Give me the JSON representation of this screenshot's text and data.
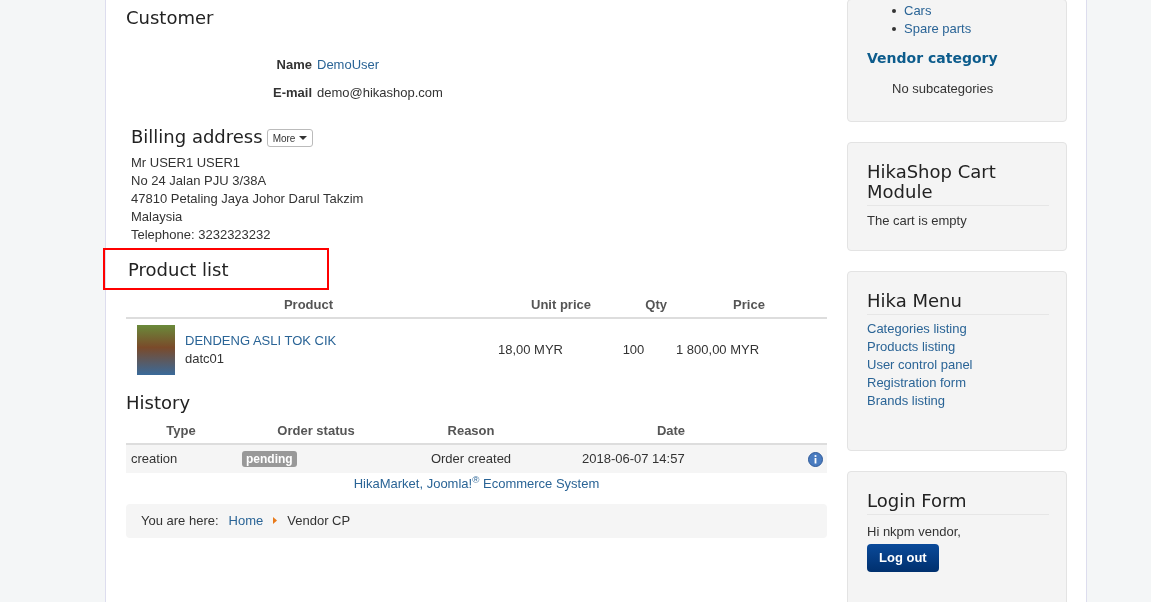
{
  "customer": {
    "title": "Customer",
    "fields": [
      {
        "label": "Name",
        "value": "DemoUser",
        "kind": "link"
      },
      {
        "label": "E-mail",
        "value": "demo@hikashop.com",
        "kind": "text"
      }
    ]
  },
  "billing": {
    "title": "Billing address",
    "more_button": "More",
    "lines": [
      "Mr USER1 USER1",
      "No 24 Jalan PJU 3/38A",
      "47810 Petaling Jaya Johor Darul Takzim",
      "Malaysia",
      "Telephone: 3232323232"
    ]
  },
  "product_list": {
    "title": "Product list",
    "highlighted": true,
    "columns": [
      "Product",
      "Unit price",
      "Qty",
      "Price"
    ],
    "rows": [
      {
        "name": "DENDENG ASLI TOK CIK",
        "code": "datc01",
        "unit_price": "18,00 MYR",
        "qty": "100",
        "price": "1 800,00 MYR"
      }
    ]
  },
  "history": {
    "title": "History",
    "columns": [
      "Type",
      "Order status",
      "Reason",
      "Date"
    ],
    "rows": [
      {
        "type": "creation",
        "status": "pending",
        "reason": "Order created",
        "date": "2018-06-07 14:57"
      }
    ]
  },
  "footer_link": "HikaMarket, Joomla!$^{®}$ Ecommerce System",
  "breadcrumb": {
    "label": "You are here:",
    "items": [
      {
        "text": "Home",
        "kind": "link"
      },
      {
        "text": "Vendor CP",
        "kind": "current"
      }
    ]
  },
  "sidebar": {
    "categories": [
      "Cars",
      "Spare parts"
    ],
    "vendor_category": {
      "title": "Vendor category",
      "text": "No subcategories"
    },
    "cart": {
      "title": "HikaShop Cart Module",
      "text": "The cart is empty"
    },
    "menu": {
      "title": "Hika Menu",
      "items": [
        "Categories listing",
        "Products listing",
        "User control panel",
        "Registration form",
        "Brands listing"
      ]
    },
    "login": {
      "title": "Login Form",
      "greeting": "Hi nkpm vendor,",
      "button": "Log out"
    }
  }
}
